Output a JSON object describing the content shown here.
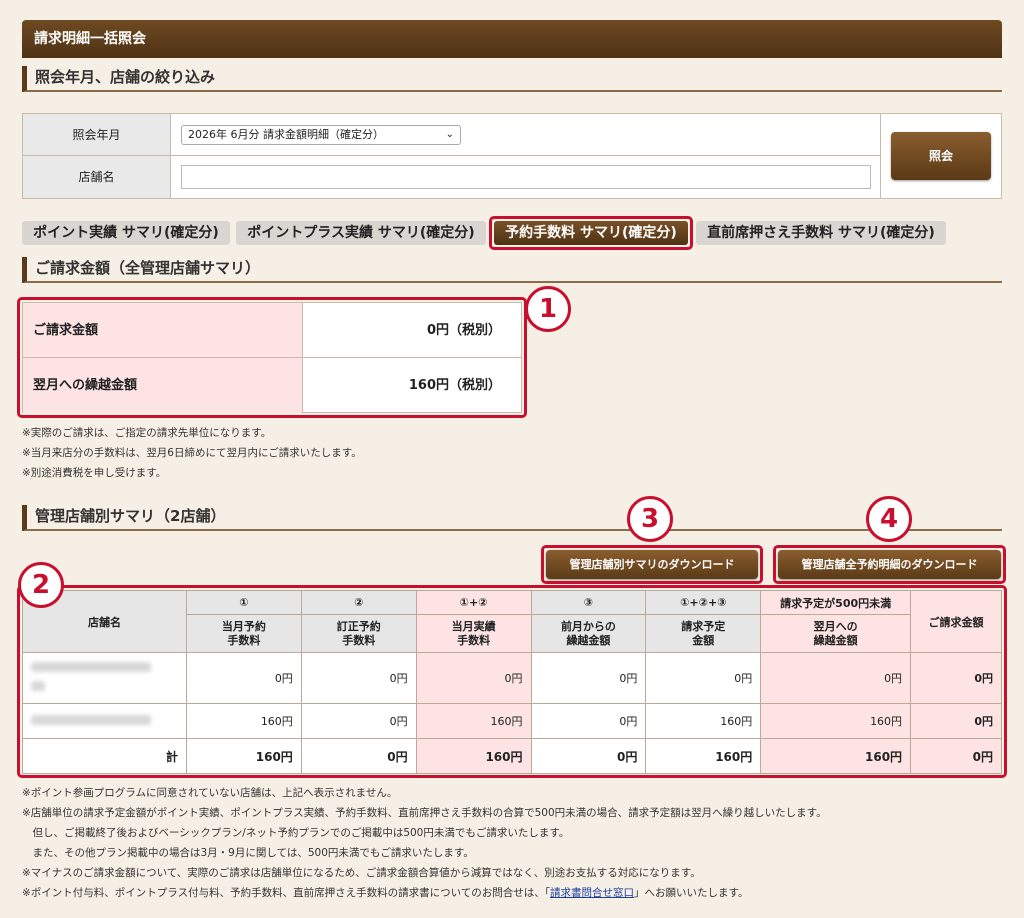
{
  "page": {
    "title": "請求明細一括照会"
  },
  "filter": {
    "heading": "照会年月、店舗の絞り込み",
    "month_label": "照会年月",
    "month_value": "2026年 6月分 請求金額明細（確定分）",
    "store_label": "店舗名",
    "store_value": "",
    "submit_label": "照会"
  },
  "tabs": [
    {
      "label": "ポイント実績 サマリ(確定分)",
      "active": false
    },
    {
      "label": "ポイントプラス実績 サマリ(確定分)",
      "active": false
    },
    {
      "label": "予約手数料 サマリ(確定分)",
      "active": true
    },
    {
      "label": "直前席押さえ手数料 サマリ(確定分)",
      "active": false
    }
  ],
  "billing": {
    "heading": "ご請求金額（全管理店舗サマリ）",
    "rows": [
      {
        "label": "ご請求金額",
        "value": "0円（税別）"
      },
      {
        "label": "翌月への繰越金額",
        "value": "160円（税別）"
      }
    ],
    "notes": [
      "※実際のご請求は、ご指定の請求先単位になります。",
      "※当月来店分の手数料は、翌月6日締めにて翌月内にご請求いたします。",
      "※別途消費税を申し受けます。"
    ]
  },
  "stores": {
    "heading": "管理店舗別サマリ（2店舗）",
    "download_summary_label": "管理店舗別サマリのダウンロード",
    "download_detail_label": "管理店舗全予約明細のダウンロード",
    "col_store": "店舗名",
    "col_marks": [
      "①",
      "②",
      "①+②",
      "③",
      "①+②+③"
    ],
    "col_group_under500": "請求予定が500円未満",
    "col_labels": [
      "当月予約\n手数料",
      "訂正予約\n手数料",
      "当月実績\n手数料",
      "前月からの\n繰越金額",
      "請求予定\n金額",
      "翌月への\n繰越金額"
    ],
    "col_billing": "ご請求金額",
    "rows": [
      {
        "values": [
          "0円",
          "0円",
          "0円",
          "0円",
          "0円",
          "0円",
          "0円"
        ]
      },
      {
        "values": [
          "160円",
          "0円",
          "160円",
          "0円",
          "160円",
          "160円",
          "0円"
        ]
      }
    ],
    "total": {
      "label": "計",
      "values": [
        "160円",
        "0円",
        "160円",
        "0円",
        "160円",
        "160円",
        "0円"
      ]
    }
  },
  "bottom_notes": [
    "※ポイント参画プログラムに同意されていない店舗は、上記へ表示されません。",
    "※店舗単位の請求予定金額がポイント実績、ポイントプラス実績、予約手数料、直前席押さえ手数料の合算で500円未満の場合、請求予定額は翌月へ繰り越しいたします。",
    "　但し、ご掲載終了後およびベーシックプラン/ネット予約プランでのご掲載中は500円未満でもご請求いたします。",
    "　また、その他プラン掲載中の場合は3月・9月に関しては、500円未満でもご請求いたします。",
    "※マイナスのご請求金額について、実際のご請求は店舗単位になるため、ご請求金額合算値から減算ではなく、別途お支払する対応になります。"
  ],
  "contact_note": {
    "prefix": "※ポイント付与料、ポイントプラス付与料、予約手数料、直前席押さえ手数料の請求書についてのお問合せは、「",
    "link": "請求書問合せ窓口",
    "suffix": "」へお願いいたします。"
  },
  "annotations": [
    "1",
    "2",
    "3",
    "4"
  ]
}
